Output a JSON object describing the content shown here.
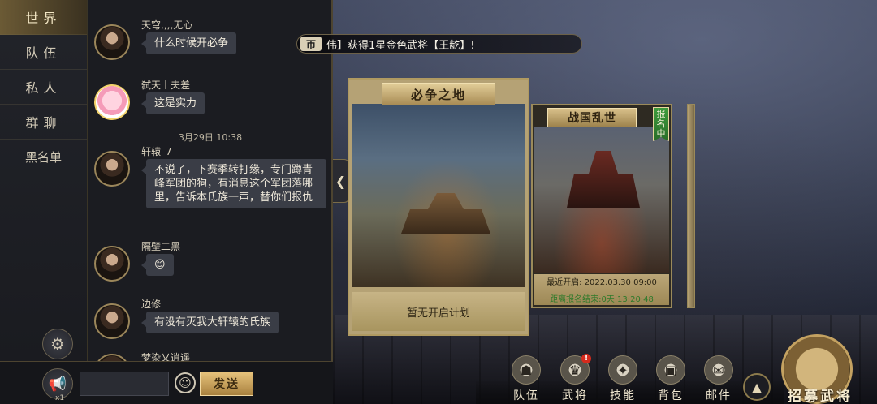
{
  "nav": {
    "items": [
      {
        "label": "世界",
        "active": true
      },
      {
        "label": "队伍",
        "active": false
      },
      {
        "label": "私人",
        "active": false
      },
      {
        "label": "群聊",
        "active": false
      },
      {
        "label": "黑名单",
        "active": false
      }
    ]
  },
  "chat": {
    "messages": [
      {
        "sender": "天穹,,,,无心",
        "text": "什么时候开必争"
      },
      {
        "sender": "弑天丨夫差",
        "text": "这是实力"
      },
      {
        "sender": "轩辕_7",
        "text": "不说了，下赛季转打缘，专门蹲青峰军团的狗，有消息这个军团落哪里，告诉本氏族一声，替你们报仇"
      },
      {
        "sender": "隔壁二黑",
        "text": "😊"
      },
      {
        "sender": "边修",
        "text": "有没有灭我大轩辕的氏族"
      },
      {
        "sender": "梦染乂逍遥",
        "text": ""
      }
    ],
    "timestamp": "3月29日 10:38"
  },
  "input": {
    "horn_count": "x1",
    "placeholder": "",
    "send_label": "发送"
  },
  "marquee": {
    "icon": "帀",
    "text": "伟】获得1星金色武将【王龁】!"
  },
  "cards": {
    "main": {
      "title": "必争之地",
      "footer": "暂无开启计划"
    },
    "second": {
      "title": "战国乱世",
      "ribbon": "报名中",
      "open_time": "最近开启: 2022.03.30 09:00",
      "countdown": "距离报名结束:0天 13:20:48"
    }
  },
  "dock": {
    "items": [
      {
        "label": "队伍",
        "icon": "team-icon"
      },
      {
        "label": "武将",
        "icon": "general-icon",
        "badge": "!"
      },
      {
        "label": "技能",
        "icon": "skill-icon"
      },
      {
        "label": "背包",
        "icon": "bag-icon"
      },
      {
        "label": "邮件",
        "icon": "mail-icon"
      }
    ],
    "recruit_label": "招募武将"
  },
  "colors": {
    "accent_gold": "#b09a61",
    "send_button": "#e6c27b",
    "badge_red": "#d62a1c",
    "countdown_green": "#2d7a2a"
  }
}
